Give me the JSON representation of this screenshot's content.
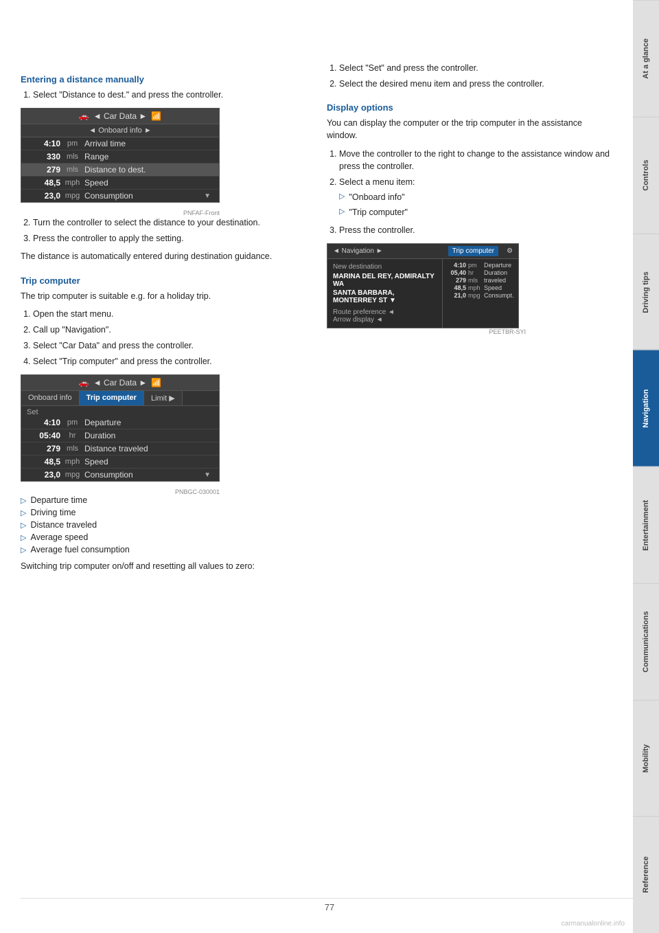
{
  "sidebar": {
    "tabs": [
      {
        "label": "At a glance",
        "active": false
      },
      {
        "label": "Controls",
        "active": false
      },
      {
        "label": "Driving tips",
        "active": false
      },
      {
        "label": "Navigation",
        "active": true
      },
      {
        "label": "Entertainment",
        "active": false
      },
      {
        "label": "Communications",
        "active": false
      },
      {
        "label": "Mobility",
        "active": false
      },
      {
        "label": "Reference",
        "active": false
      }
    ]
  },
  "left": {
    "section1_heading": "Entering a distance manually",
    "section1_steps": [
      "Select \"Distance to dest.\" and press the controller.",
      "Turn the controller to select the distance to your destination.",
      "Press the controller to apply the setting."
    ],
    "section1_note": "The distance is automatically entered during destination guidance.",
    "cardata1_header": "◄  Car Data  ►",
    "cardata1_subheader": "◄  Onboard info  ►",
    "cardata1_rows": [
      {
        "val": "4:10",
        "unit": "pm",
        "label": "Arrival time",
        "highlighted": false
      },
      {
        "val": "330",
        "unit": "mls",
        "label": "Range",
        "highlighted": false
      },
      {
        "val": "279",
        "unit": "mls",
        "label": "Distance to dest.",
        "highlighted": true
      },
      {
        "val": "48,5",
        "unit": "mph",
        "label": "Speed",
        "highlighted": false
      },
      {
        "val": "23,0",
        "unit": "mpg",
        "label": "Consumption",
        "highlighted": false
      }
    ],
    "section2_heading": "Trip computer",
    "section2_intro": "The trip computer is suitable e.g. for a holiday trip.",
    "section2_steps": [
      "Open the start menu.",
      "Call up \"Navigation\".",
      "Select \"Car Data\" and press the controller.",
      "Select \"Trip computer\" and press the controller."
    ],
    "tripdata_header": "◄  Car Data  ►",
    "tripdata_tabs": [
      {
        "label": "Onboard info",
        "active": false
      },
      {
        "label": "Trip computer",
        "active": true
      },
      {
        "label": "Limit",
        "active": false
      }
    ],
    "tripdata_set": "Set",
    "tripdata_rows": [
      {
        "val": "4:10",
        "unit": "pm",
        "label": "Departure"
      },
      {
        "val": "05:40",
        "unit": "hr",
        "label": "Duration"
      },
      {
        "val": "279",
        "unit": "mls",
        "label": "Distance traveled"
      },
      {
        "val": "48,5",
        "unit": "mph",
        "label": "Speed"
      },
      {
        "val": "23,0",
        "unit": "mpg",
        "label": "Consumption"
      }
    ],
    "bullet_items": [
      "Departure time",
      "Driving time",
      "Distance traveled",
      "Average speed",
      "Average fuel consumption"
    ],
    "switch_note": "Switching trip computer on/off and resetting all values to zero:"
  },
  "right": {
    "right_steps_1": [
      "Select \"Set\" and press the controller.",
      "Select the desired menu item and press the controller."
    ],
    "section3_heading": "Display options",
    "section3_intro": "You can display the computer or the trip computer in the assistance window.",
    "section3_steps": [
      "Move the controller to the right to change to the assistance window and press the controller.",
      "Select a menu item:",
      "Press the controller."
    ],
    "menu_items": [
      "\"Onboard info\"",
      "\"Trip computer\""
    ],
    "nav_header_left": "◄  Navigation  ►",
    "nav_header_right": "Trip computer",
    "nav_dest_title": "New destination",
    "nav_dest_lines": [
      "MARINA DEL REY, ADMIRALTY WA",
      "SANTA BARBARA, MONTERREY ST"
    ],
    "nav_links": [
      "Route preference ◄",
      "Arrow display ◄"
    ],
    "nav_data_rows": [
      {
        "val": "4:10",
        "unit": "pm",
        "label": "Departure"
      },
      {
        "val": "05,40",
        "unit": "hr",
        "label": "Duration"
      },
      {
        "val": "279",
        "unit": "mls",
        "label": "traveled"
      },
      {
        "val": "48,5",
        "unit": "mph",
        "label": "Speed"
      },
      {
        "val": "21,0",
        "unit": "mpg",
        "label": "Consumpt."
      }
    ]
  },
  "page": {
    "number": "77",
    "watermark": "carmanualonline.info"
  }
}
